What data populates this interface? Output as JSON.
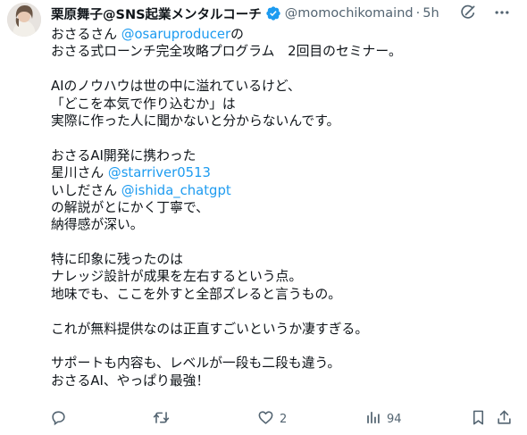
{
  "author": {
    "name": "栗原舞子@SNS起業メンタルコーチ",
    "handle": "@momochikomaind",
    "time": "5h",
    "verified_color": "#1d9bf0"
  },
  "tweet_lines": [
    [
      {
        "text": "おさるさん "
      },
      {
        "text": "@osaruproducer",
        "mention": true
      },
      {
        "text": "の"
      }
    ],
    [
      {
        "text": "おさる式ローンチ完全攻略プログラム　2回目のセミナー。"
      }
    ],
    [],
    [
      {
        "text": "AIのノウハウは世の中に溢れているけど、"
      }
    ],
    [
      {
        "text": "「どこを本気で作り込むか」は"
      }
    ],
    [
      {
        "text": "実際に作った人に聞かないと分からないんです。"
      }
    ],
    [],
    [
      {
        "text": "おさるAI開発に携わった"
      }
    ],
    [
      {
        "text": "星川さん "
      },
      {
        "text": "@starriver0513",
        "mention": true
      }
    ],
    [
      {
        "text": "いしださん "
      },
      {
        "text": "@ishida_chatgpt",
        "mention": true
      }
    ],
    [
      {
        "text": "の解説がとにかく丁寧で、"
      }
    ],
    [
      {
        "text": "納得感が深い。"
      }
    ],
    [],
    [
      {
        "text": "特に印象に残ったのは"
      }
    ],
    [
      {
        "text": "ナレッジ設計が成果を左右するという点。"
      }
    ],
    [
      {
        "text": "地味でも、ここを外すと全部ズレると言うもの。"
      }
    ],
    [],
    [
      {
        "text": "これが無料提供なのは正直すごいというか凄すぎる。"
      }
    ],
    [],
    [
      {
        "text": "サポートも内容も、レベルが一段も二段も違う。"
      }
    ],
    [
      {
        "text": "おさるAI、やっぱり最強！"
      }
    ]
  ],
  "actions": {
    "reply_icon": "reply-icon",
    "retweet_icon": "retweet-icon",
    "like_icon": "heart-icon",
    "like_count": "2",
    "views_icon": "views-chart-icon",
    "views_count": "94",
    "bookmark_icon": "bookmark-icon",
    "share_icon": "share-icon"
  },
  "header_icons": [
    "grok-icon",
    "more-icon"
  ],
  "colors": {
    "text": "#0f1419",
    "secondary": "#536471",
    "mention": "#1d9bf0"
  }
}
